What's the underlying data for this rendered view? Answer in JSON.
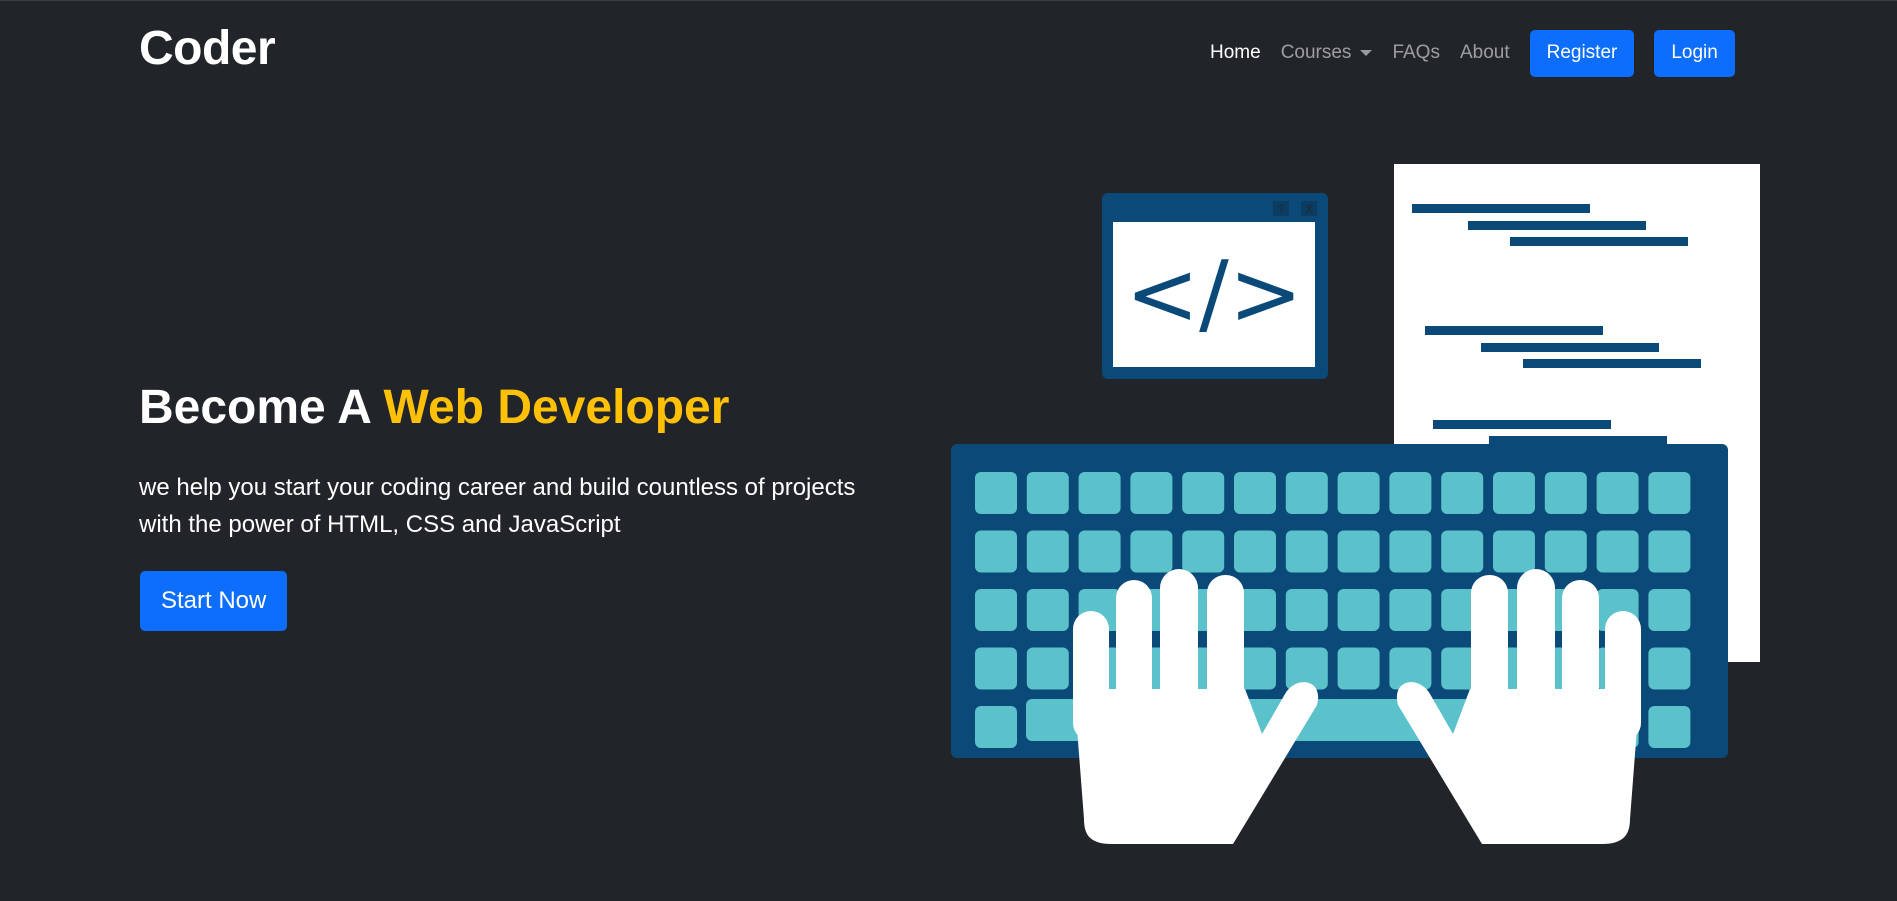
{
  "header": {
    "brand": "Coder",
    "nav": {
      "home": "Home",
      "courses": "Courses",
      "faqs": "FAQs",
      "about": "About",
      "register": "Register",
      "login": "Login"
    }
  },
  "hero": {
    "title_prefix": "Become A ",
    "title_highlight": "Web Developer",
    "description": "we help you start your coding career and build countless of projects with the power of HTML, CSS and JavaScript",
    "cta": "Start Now"
  },
  "illustration": {
    "code_window_text": "</>",
    "window_help_label": "?",
    "window_close_label": "X",
    "icon": "typing-on-keyboard-illustration"
  },
  "colors": {
    "background": "#212529",
    "accent_yellow": "#ffc107",
    "primary_blue": "#0d6efd",
    "illustration_navy": "#0b4a78",
    "key_teal": "#5bc1ca"
  }
}
